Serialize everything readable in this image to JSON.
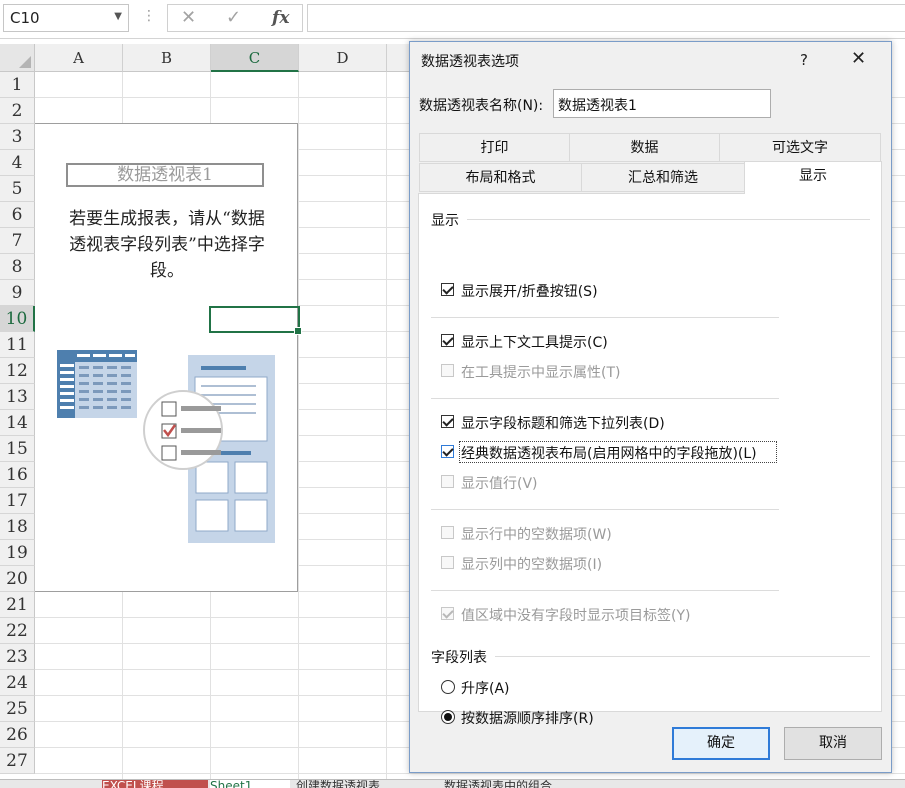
{
  "formula_bar": {
    "name_box": "C10",
    "dots": "⋮",
    "cancel_symbol": "✕",
    "enter_symbol": "✓",
    "fx_label": "fx",
    "formula_value": ""
  },
  "sheet": {
    "columns": [
      "A",
      "B",
      "C",
      "D"
    ],
    "selected_column": "C",
    "rows": [
      "1",
      "2",
      "3",
      "4",
      "5",
      "6",
      "7",
      "8",
      "9",
      "10",
      "11",
      "12",
      "13",
      "14",
      "15",
      "16",
      "17",
      "18",
      "19",
      "20",
      "21",
      "22",
      "23",
      "24",
      "25",
      "26",
      "27"
    ],
    "selected_row": "10",
    "pivot_placeholder": {
      "title": "数据透视表1",
      "hint_line1": "若要生成报表，请从“数据",
      "hint_line2": "透视表字段列表”中选择字",
      "hint_line3": "段。"
    },
    "tabs": [
      "EXCEL课程",
      "Sheet1",
      "创建数据透视表",
      "数据透视表中的组合"
    ]
  },
  "dialog": {
    "title": "数据透视表选项",
    "help_symbol": "?",
    "close_symbol": "✕",
    "name_label": "数据透视表名称(N):",
    "name_value": "数据透视表1",
    "tabs_row1": [
      "打印",
      "数据",
      "可选文字"
    ],
    "tabs_row2": [
      "布局和格式",
      "汇总和筛选",
      "显示"
    ],
    "active_tab": "显示",
    "section_display": "显示",
    "options": [
      {
        "label": "显示展开/折叠按钮(S)",
        "checked": true,
        "enabled": true
      },
      {
        "label": "显示上下文工具提示(C)",
        "checked": true,
        "enabled": true
      },
      {
        "label": "在工具提示中显示属性(T)",
        "checked": false,
        "enabled": false
      },
      {
        "label": "显示字段标题和筛选下拉列表(D)",
        "checked": true,
        "enabled": true
      },
      {
        "label": "经典数据透视表布局(启用网格中的字段拖放)(L)",
        "checked": true,
        "enabled": true,
        "focused": true
      },
      {
        "label": "显示值行(V)",
        "checked": false,
        "enabled": false
      },
      {
        "label": "显示行中的空数据项(W)",
        "checked": false,
        "enabled": false
      },
      {
        "label": "显示列中的空数据项(I)",
        "checked": false,
        "enabled": false
      },
      {
        "label": "值区域中没有字段时显示项目标签(Y)",
        "checked": true,
        "enabled": false
      }
    ],
    "section_field_list": "字段列表",
    "sort_options": [
      {
        "label": "升序(A)",
        "selected": false
      },
      {
        "label": "按数据源顺序排序(R)",
        "selected": true
      }
    ],
    "ok_label": "确定",
    "cancel_label": "取消"
  },
  "colors": {
    "excel_green": "#217346",
    "illustration_blue": "#4e7fae",
    "illustration_light": "#c5d5e8",
    "check_orange": "#c0504d",
    "focus_blue": "#2f7bd8"
  }
}
